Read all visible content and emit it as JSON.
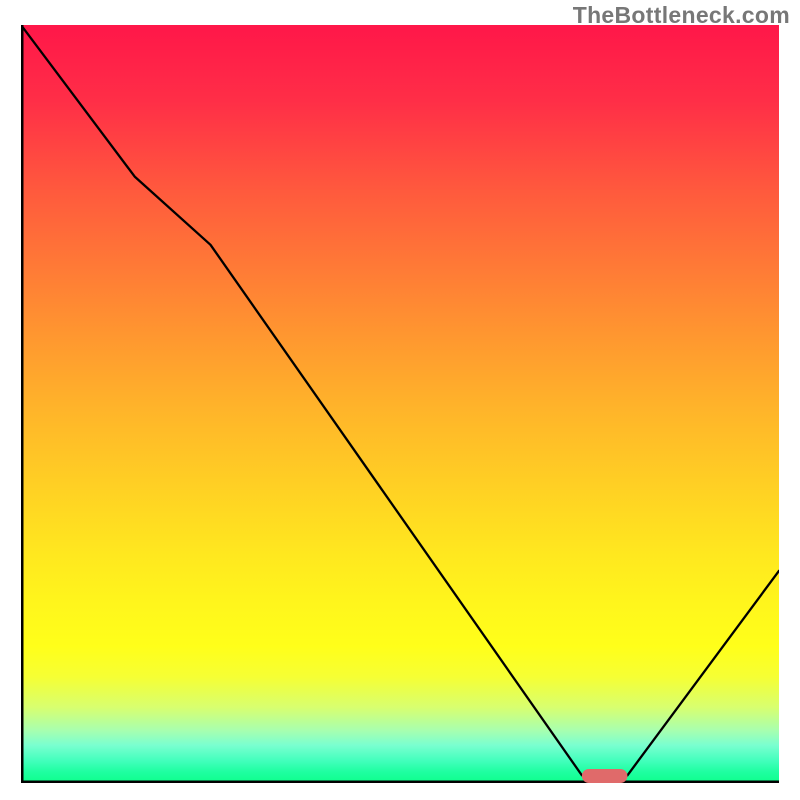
{
  "watermark": "TheBottleneck.com",
  "chart_data": {
    "type": "line",
    "title": "",
    "xlabel": "",
    "ylabel": "",
    "xlim": [
      0,
      100
    ],
    "ylim": [
      0,
      100
    ],
    "grid": false,
    "x": [
      0,
      15,
      25,
      74,
      80,
      100
    ],
    "values": [
      100,
      80,
      71,
      1,
      1,
      28
    ],
    "optimal_range_x": [
      74,
      80
    ],
    "background": "rainbow-gradient-red-to-green",
    "background_meaning": "higher y value = red (bad), lower y = green (good)"
  },
  "colors": {
    "curve": "#000000",
    "axis": "#000000",
    "marker": "#e06a6a",
    "watermark": "#777777"
  }
}
